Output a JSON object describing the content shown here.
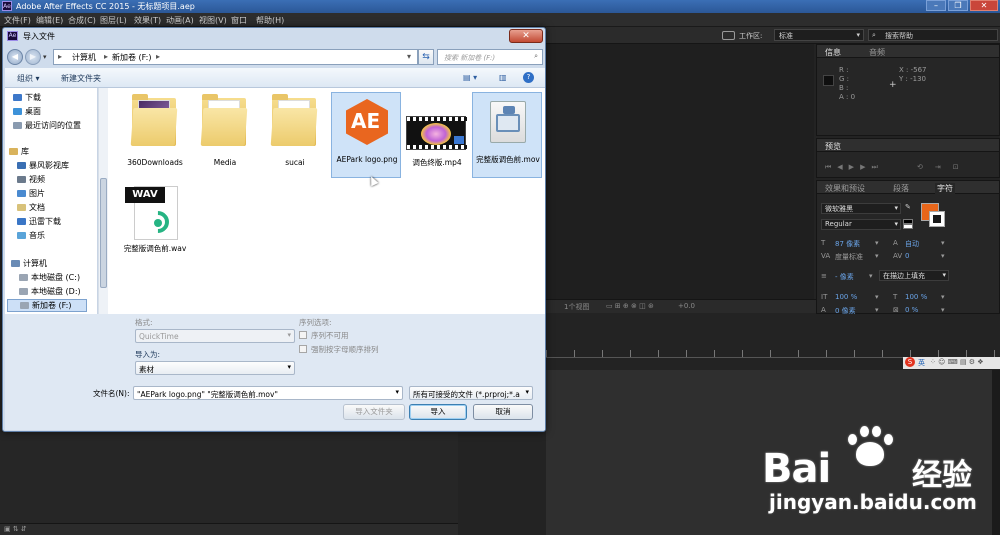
{
  "app": {
    "title": "Adobe After Effects CC 2015 - 无标题项目.aep",
    "logo": "Ae"
  },
  "menu": [
    "文件(F)",
    "编辑(E)",
    "合成(C)",
    "图层(L)",
    "效果(T)",
    "动画(A)",
    "视图(V)",
    "窗口",
    "帮助(H)"
  ],
  "toolbar": {
    "workspace_label": "工作区:",
    "workspace_value": "标准",
    "search_help": "搜索帮助"
  },
  "dialog": {
    "title": "导入文件",
    "logo": "Ae",
    "address": [
      "计算机",
      "新加卷 (F:)"
    ],
    "search_placeholder": "搜索 新加卷 (F:)",
    "organize": "组织 ▾",
    "new_folder": "新建文件夹",
    "nav": {
      "favorites": [
        "下载",
        "桌面",
        "最近访问的位置"
      ],
      "library_header": "库",
      "libraries": [
        "暴风影视库",
        "视频",
        "图片",
        "文档",
        "迅雷下载",
        "音乐"
      ],
      "computer_header": "计算机",
      "drives": [
        "本地磁盘 (C:)",
        "本地磁盘 (D:)",
        "新加卷 (F:)"
      ]
    },
    "files": [
      {
        "name": "360Downloads",
        "kind": "folder"
      },
      {
        "name": "Media",
        "kind": "folder"
      },
      {
        "name": "sucai",
        "kind": "folder"
      },
      {
        "name": "AEPark logo.png",
        "kind": "png",
        "selected": true,
        "icon_text": "AE"
      },
      {
        "name": "调色终版.mp4",
        "kind": "mp4"
      },
      {
        "name": "完整版调色前.mov",
        "kind": "mov",
        "selected": true
      },
      {
        "name": "完整版调色前.wav",
        "kind": "wav",
        "icon_text": "WAV"
      }
    ],
    "format_label": "格式:",
    "format_value": "QuickTime",
    "sequence_label": "序列选项:",
    "sequence_unavailable": "序列不可用",
    "force_alpha": "强制按字母顺序排列",
    "import_as_label": "导入为:",
    "import_as_value": "素材",
    "filename_label": "文件名(N):",
    "filename_value": "\"AEPark logo.png\" \"完整版调色前.mov\"",
    "filetype_value": "所有可接受的文件 (*.prproj;*.a",
    "import_folder_btn": "导入文件夹",
    "import_btn": "导入",
    "cancel_btn": "取消"
  },
  "info_panel": {
    "tabs": [
      "信息",
      "音频"
    ],
    "r": "R :",
    "g": "G :",
    "b": "B :",
    "a": "A : 0",
    "x": "X : -567",
    "y": "Y : -130"
  },
  "preview_panel": {
    "title": "预览"
  },
  "char_panel": {
    "tabs": [
      "效果和预设",
      "段落",
      "字符"
    ],
    "font": "微软雅黑",
    "style": "Regular",
    "size": "87 像素",
    "leading": "自动",
    "kerning": "度量标准",
    "tracking": "0",
    "stroke_size": "- 像素",
    "stroke_mode": "在描边上填充",
    "vscale": "100 %",
    "hscale": "100 %",
    "baseline": "0 像素",
    "tsume": "0 %",
    "fill_color": "#e8661a"
  },
  "comp_footer": {
    "views": "1个视图",
    "offset": "+0.0"
  },
  "ime": {
    "label": "英"
  },
  "watermark": {
    "brand_left": "Bai",
    "brand_right": "经验",
    "url": "jingyan.baidu.com"
  }
}
